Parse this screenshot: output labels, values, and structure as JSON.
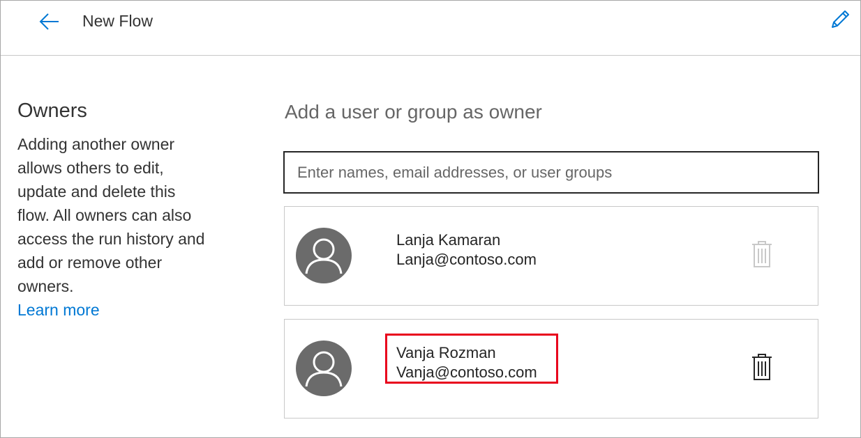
{
  "header": {
    "title": "New Flow",
    "back_icon": "arrow-left-icon",
    "edit_icon": "pencil-icon"
  },
  "owners_section": {
    "title": "Owners",
    "description": "Adding another owner allows others to edit, update and delete this flow. All owners can also access the run history and add or remove other owners.",
    "learn_more": "Learn more"
  },
  "add_owner": {
    "heading": "Add a user or group as owner",
    "placeholder": "Enter names, email addresses, or user groups",
    "value": ""
  },
  "owners": [
    {
      "name": "Lanja Kamaran",
      "email": "Lanja@contoso.com",
      "delete_enabled": false
    },
    {
      "name": "Vanja Rozman",
      "email": "Vanja@contoso.com",
      "delete_enabled": true
    }
  ],
  "colors": {
    "accent": "#0078d4",
    "avatar": "#6b6b6b",
    "highlight": "#e8001c",
    "disabled_icon": "#c8c8c8"
  }
}
